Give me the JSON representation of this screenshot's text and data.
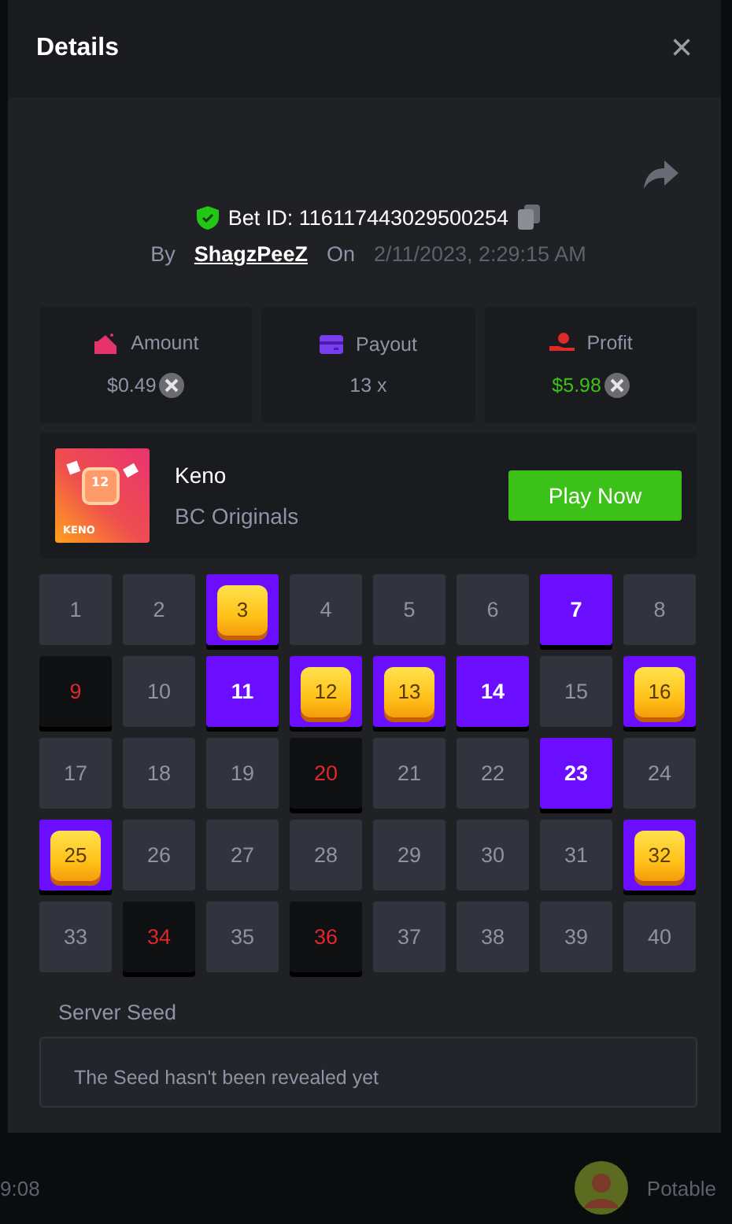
{
  "dialog": {
    "title": "Details",
    "close": "×"
  },
  "bet": {
    "id_label": "Bet ID: 116117443029500254",
    "by_label": "By",
    "user": "ShagzPeeZ",
    "on_label": "On",
    "date": "2/11/2023, 2:29:15 AM"
  },
  "stats": [
    {
      "kind": "amount",
      "label": "Amount",
      "value": "$0.49",
      "coin": true,
      "positive": false
    },
    {
      "kind": "payout",
      "label": "Payout",
      "value": "13 x",
      "coin": false,
      "positive": false
    },
    {
      "kind": "profit",
      "label": "Profit",
      "value": "$5.98",
      "coin": true,
      "positive": true
    }
  ],
  "game": {
    "name": "Keno",
    "provider": "BC Originals",
    "thumb_number": "12",
    "thumb_label": "KENO",
    "play": "Play Now"
  },
  "cells": [
    {
      "n": "1",
      "kind": "plain"
    },
    {
      "n": "2",
      "kind": "plain"
    },
    {
      "n": "3",
      "kind": "hit"
    },
    {
      "n": "4",
      "kind": "plain"
    },
    {
      "n": "5",
      "kind": "plain"
    },
    {
      "n": "6",
      "kind": "plain"
    },
    {
      "n": "7",
      "kind": "picked"
    },
    {
      "n": "8",
      "kind": "plain"
    },
    {
      "n": "9",
      "kind": "drawn"
    },
    {
      "n": "10",
      "kind": "plain"
    },
    {
      "n": "11",
      "kind": "picked"
    },
    {
      "n": "12",
      "kind": "hit"
    },
    {
      "n": "13",
      "kind": "hit"
    },
    {
      "n": "14",
      "kind": "picked"
    },
    {
      "n": "15",
      "kind": "plain"
    },
    {
      "n": "16",
      "kind": "hit"
    },
    {
      "n": "17",
      "kind": "plain"
    },
    {
      "n": "18",
      "kind": "plain"
    },
    {
      "n": "19",
      "kind": "plain"
    },
    {
      "n": "20",
      "kind": "drawn"
    },
    {
      "n": "21",
      "kind": "plain"
    },
    {
      "n": "22",
      "kind": "plain"
    },
    {
      "n": "23",
      "kind": "picked"
    },
    {
      "n": "24",
      "kind": "plain"
    },
    {
      "n": "25",
      "kind": "hit"
    },
    {
      "n": "26",
      "kind": "plain"
    },
    {
      "n": "27",
      "kind": "plain"
    },
    {
      "n": "28",
      "kind": "plain"
    },
    {
      "n": "29",
      "kind": "plain"
    },
    {
      "n": "30",
      "kind": "plain"
    },
    {
      "n": "31",
      "kind": "plain"
    },
    {
      "n": "32",
      "kind": "hit"
    },
    {
      "n": "33",
      "kind": "plain"
    },
    {
      "n": "34",
      "kind": "drawn"
    },
    {
      "n": "35",
      "kind": "plain"
    },
    {
      "n": "36",
      "kind": "drawn"
    },
    {
      "n": "37",
      "kind": "plain"
    },
    {
      "n": "38",
      "kind": "plain"
    },
    {
      "n": "39",
      "kind": "plain"
    },
    {
      "n": "40",
      "kind": "plain"
    }
  ],
  "seed": {
    "label": "Server Seed",
    "text": "The Seed hasn't been revealed yet"
  },
  "background": {
    "time": "9:08",
    "player": "Potable"
  }
}
